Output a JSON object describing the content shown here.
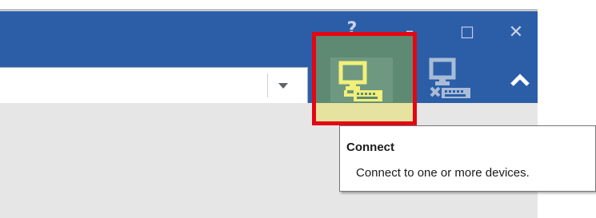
{
  "window_controls": {
    "help_glyph": "?",
    "minimize_glyph": "–",
    "maximize_glyph": "☐",
    "close_glyph": "✕"
  },
  "toolbar": {
    "connect_icon": "monitor-connect-icon",
    "disconnect_icon": "monitor-disconnect-icon",
    "collapse_icon": "chevron-up-icon",
    "dropdown_icon": "dropdown-arrow-icon"
  },
  "tooltip": {
    "title": "Connect",
    "description": "Connect to one or more devices."
  },
  "colors": {
    "ribbon": "#2c5ea8",
    "highlight_frame": "#e30613",
    "connect_icon": "#f2f07a",
    "hover_background": "#5e8a73",
    "content_area": "#e6e6e6"
  }
}
